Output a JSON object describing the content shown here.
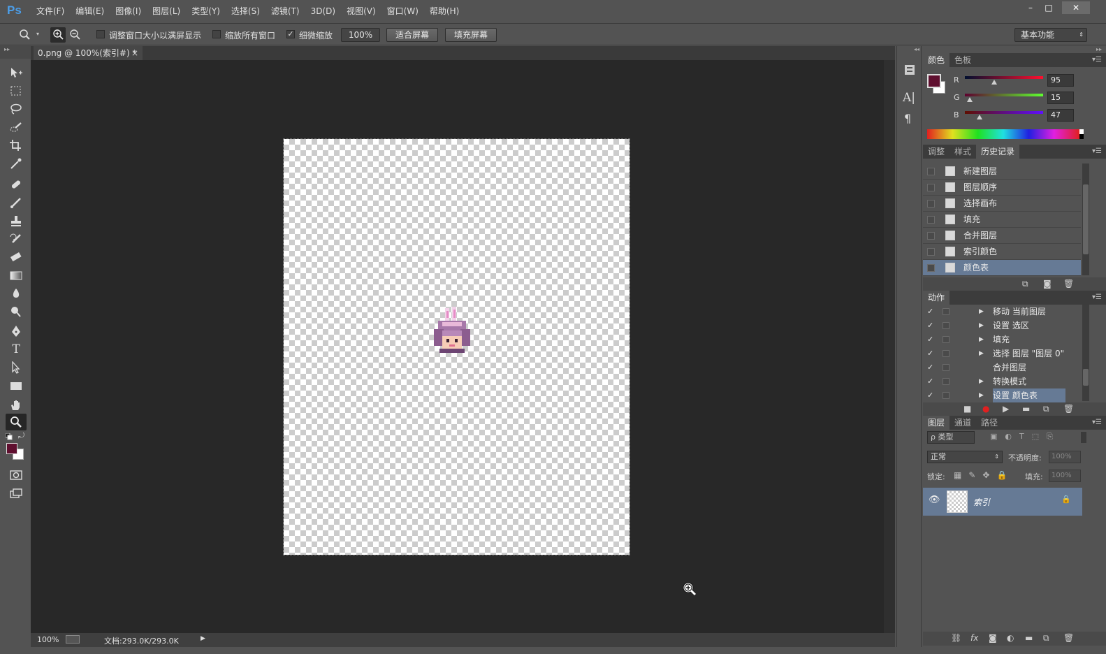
{
  "app": {
    "logo": "Ps"
  },
  "menubar": {
    "items": [
      "文件(F)",
      "编辑(E)",
      "图像(I)",
      "图层(L)",
      "类型(Y)",
      "选择(S)",
      "滤镜(T)",
      "3D(D)",
      "视图(V)",
      "窗口(W)",
      "帮助(H)"
    ],
    "win_min": "–",
    "win_max": "□",
    "win_close": "✕"
  },
  "options": {
    "resize_label": "调整窗口大小以满屏显示",
    "zoom_all_label": "缩放所有窗口",
    "scrubby_label": "细微缩放",
    "scrubby_checked": "✓",
    "zoom_value": "100%",
    "fit_screen": "适合屏幕",
    "fill_screen": "填充屏幕",
    "workspace": "基本功能"
  },
  "document": {
    "tab_title": "0.png @ 100%(索引#) *",
    "tab_close": "×"
  },
  "status": {
    "zoom": "100%",
    "doc_size": "文档:293.0K/293.0K",
    "arrow": "▶"
  },
  "color_panel": {
    "tabs": [
      "颜色",
      "色板"
    ],
    "r_label": "R",
    "g_label": "G",
    "b_label": "B",
    "r": "95",
    "g": "15",
    "b": "47",
    "r_level": 0.373,
    "g_level": 0.059,
    "b_level": 0.184,
    "foreground": "#5f0f2f",
    "background": "#ffffff"
  },
  "history_panel": {
    "tabs": [
      "调整",
      "样式",
      "历史记录"
    ],
    "items": [
      "新建图层",
      "图层顺序",
      "选择画布",
      "填充",
      "合并图层",
      "索引颜色",
      "颜色表"
    ]
  },
  "actions_panel": {
    "tab": "动作",
    "items": [
      {
        "label": "移动 当前图层",
        "arrow": "▶"
      },
      {
        "label": "设置 选区",
        "arrow": "▶"
      },
      {
        "label": "填充",
        "arrow": "▶"
      },
      {
        "label": "选择 图层 \"图层 0\"",
        "arrow": "▶"
      },
      {
        "label": "合并图层",
        "arrow": ""
      },
      {
        "label": "转换模式",
        "arrow": "▶"
      },
      {
        "label": "设置 颜色表",
        "arrow": "▶"
      }
    ],
    "check": "✓"
  },
  "layers_panel": {
    "tabs": [
      "图层",
      "通道",
      "路径"
    ],
    "filter": "ρ 类型",
    "blend_mode": "正常",
    "opacity_label": "不透明度:",
    "opacity_value": "100%",
    "lock_label": "锁定:",
    "fill_label": "填充:",
    "fill_value": "100%",
    "layer_name": "索引"
  },
  "colors": {
    "accent": "#667a95",
    "canvas_bg": "#282828",
    "panel": "#535353"
  }
}
